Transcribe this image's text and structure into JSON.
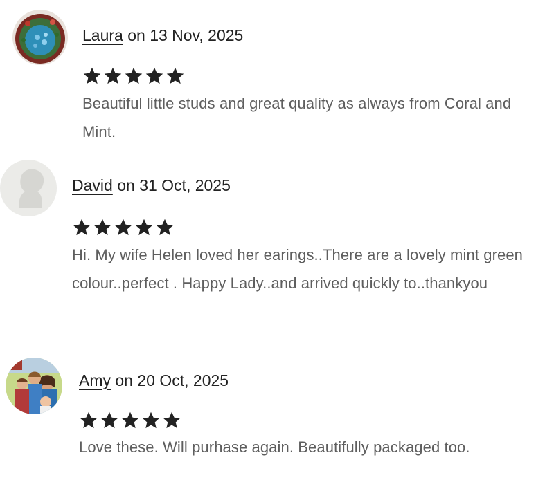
{
  "reviews": [
    {
      "reviewer": "Laura",
      "date_prefix": "on",
      "date": "13 Nov, 2025",
      "rating": 5,
      "rating_max": 5,
      "avatar": "laura-avatar-photo",
      "text": "Beautiful little studs and great quality as always from Coral and Mint."
    },
    {
      "reviewer": "David",
      "date_prefix": "on",
      "date": "31 Oct, 2025",
      "rating": 5,
      "rating_max": 5,
      "avatar": "default-user-silhouette",
      "text": "Hi. My wife Helen loved her earings..There are a lovely mint green colour..perfect . Happy Lady..and arrived quickly to..thankyou"
    },
    {
      "reviewer": "Amy",
      "date_prefix": "on",
      "date": "20 Oct, 2025",
      "rating": 5,
      "rating_max": 5,
      "avatar": "amy-family-photo",
      "text": "Love these. Will purhase again. Beautifully packaged too."
    }
  ],
  "colors": {
    "text_primary": "#222222",
    "text_secondary": "#5e5e5e",
    "star": "#222222"
  },
  "icons": {
    "star": "star-filled-icon"
  }
}
